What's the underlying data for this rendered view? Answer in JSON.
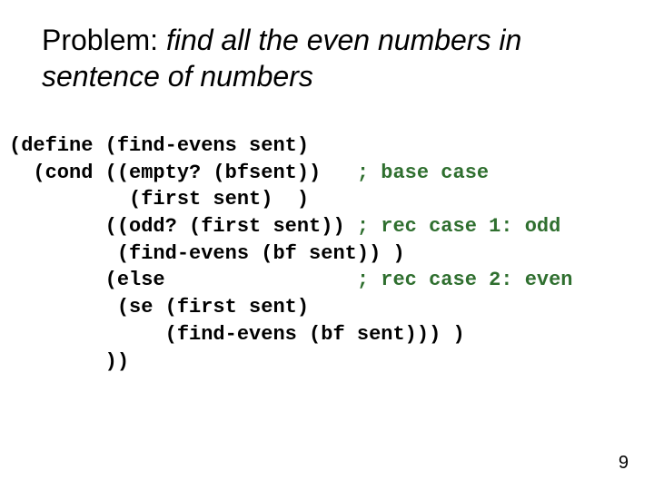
{
  "title_plain": "Problem: ",
  "title_italic": "find all the even numbers in sentence of numbers",
  "code": {
    "l1a": "(define (find-evens sent)",
    "l2a": "  (cond ((empty? (bfsent))   ",
    "l2c": "; base case",
    "l3a": "          (first sent)  )",
    "l4a": "        ((odd? (first sent)) ",
    "l4c": "; rec case 1: odd",
    "l5a": "         (find-evens (bf sent)) )",
    "l6a": "        (else                ",
    "l6c": "; rec case 2: even",
    "l7a": "         (se (first sent)",
    "l8a": "             (find-evens (bf sent))) )",
    "l9a": "        ))"
  },
  "pagenum": "9"
}
